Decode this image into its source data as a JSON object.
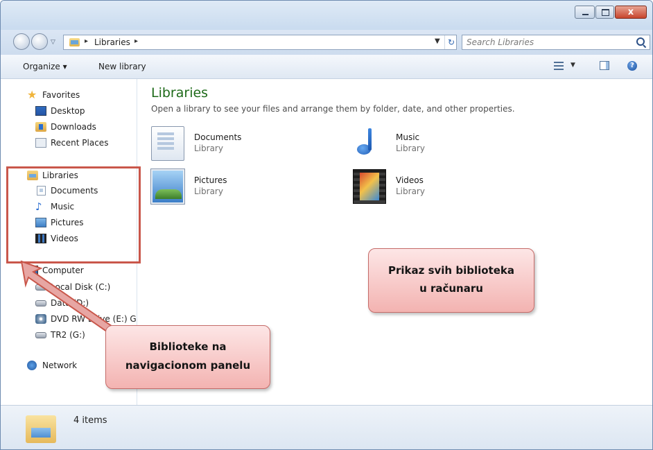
{
  "window": {
    "buttons": {
      "minimize": "–",
      "maximize": "□",
      "close": "x"
    }
  },
  "address": {
    "crumb": "Libraries",
    "search_placeholder": "Search Libraries"
  },
  "toolbar": {
    "organize": "Organize ▾",
    "new_library": "New library"
  },
  "nav": {
    "favorites": "Favorites",
    "desktop": "Desktop",
    "downloads": "Downloads",
    "recent": "Recent Places",
    "libraries": "Libraries",
    "documents": "Documents",
    "music": "Music",
    "pictures": "Pictures",
    "videos": "Videos",
    "computer": "Computer",
    "local_disk": "Local Disk (C:)",
    "data": "Data (D:)",
    "dvd": "DVD RW Drive (E:) G",
    "tr2": "TR2 (G:)",
    "network": "Network"
  },
  "content": {
    "title": "Libraries",
    "description": "Open a library to see your files and arrange them by folder, date, and other properties.",
    "libraries": [
      {
        "name": "Documents",
        "type": "Library",
        "icon": "documents-library-icon"
      },
      {
        "name": "Music",
        "type": "Library",
        "icon": "music-library-icon"
      },
      {
        "name": "Pictures",
        "type": "Library",
        "icon": "pictures-library-icon"
      },
      {
        "name": "Videos",
        "type": "Library",
        "icon": "videos-library-icon"
      }
    ]
  },
  "callouts": {
    "right_line1": "Prikaz svih biblioteka",
    "right_line2": "u računaru",
    "left_line1": "Biblioteke na",
    "left_line2": "navigacionom panelu"
  },
  "status": {
    "count": "4 items"
  },
  "colors": {
    "callout_border": "#c9574b",
    "title_green": "#1e6a19"
  }
}
